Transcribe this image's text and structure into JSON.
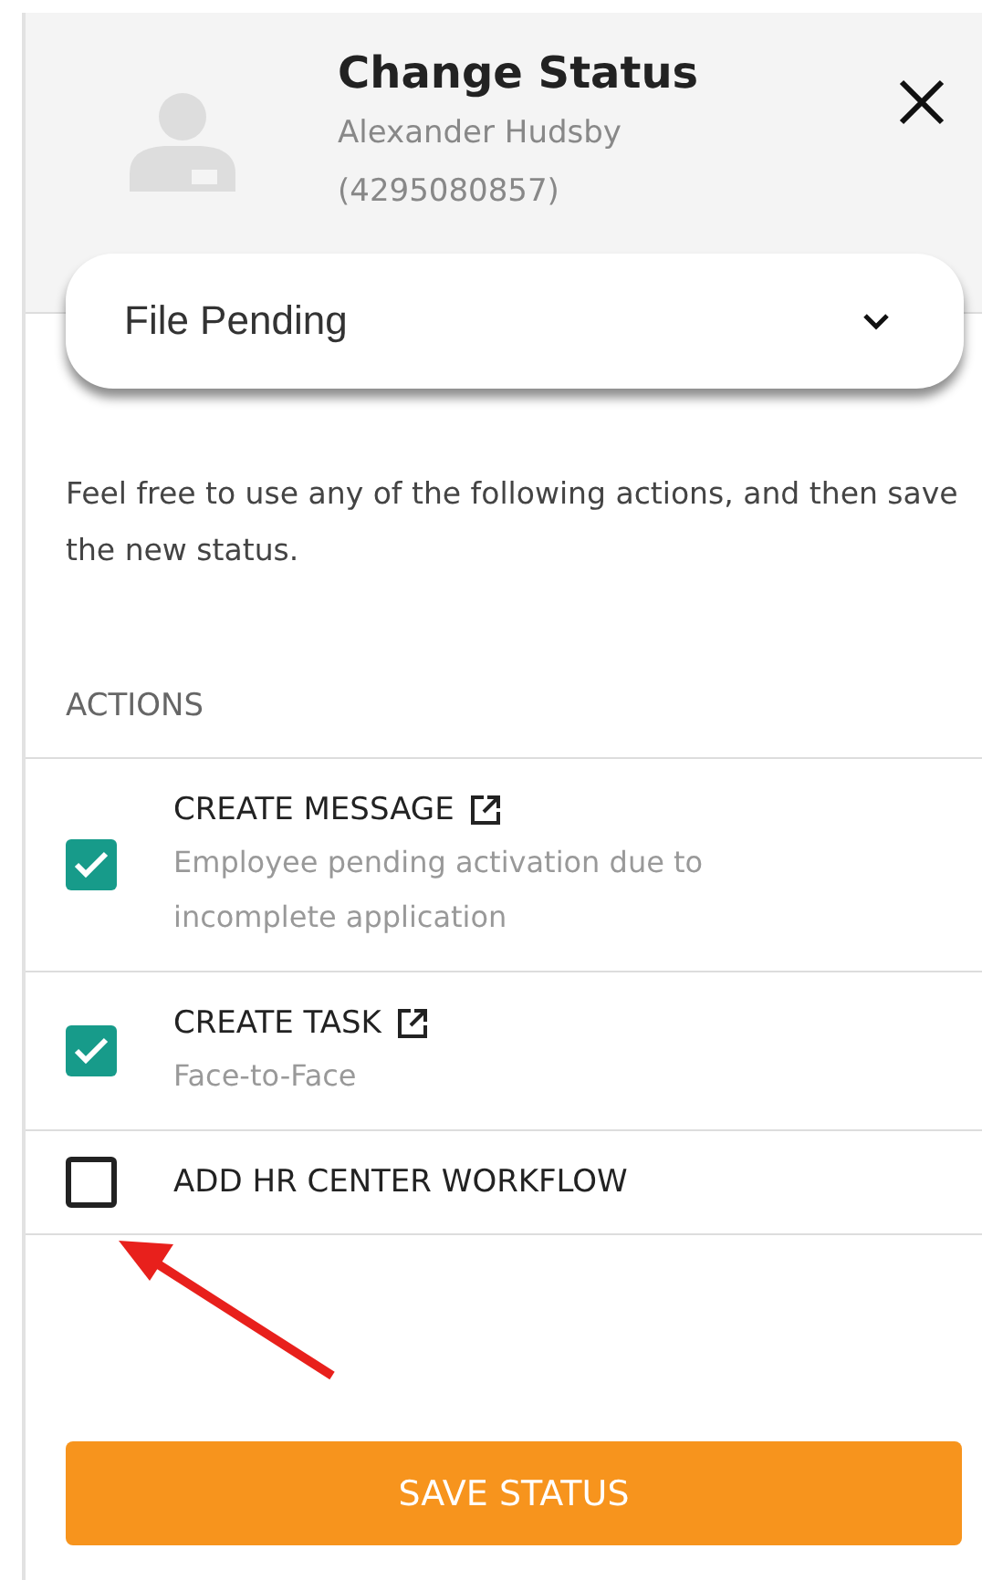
{
  "header": {
    "title": "Change Status",
    "name": "Alexander Hudsby",
    "id_number": "(4295080857)"
  },
  "status_select": {
    "value": "File Pending"
  },
  "intro": "Feel free to use any of the following actions, and then save the new status.",
  "section_label": "ACTIONS",
  "actions": [
    {
      "label": "CREATE MESSAGE",
      "external_link": true,
      "detail": "Employee pending activation due to incomplete application",
      "checked": true
    },
    {
      "label": "CREATE TASK",
      "external_link": true,
      "detail": "Face-to-Face",
      "checked": true
    },
    {
      "label": "ADD HR CENTER WORKFLOW",
      "external_link": false,
      "checked": false
    }
  ],
  "save_button": "SAVE STATUS"
}
